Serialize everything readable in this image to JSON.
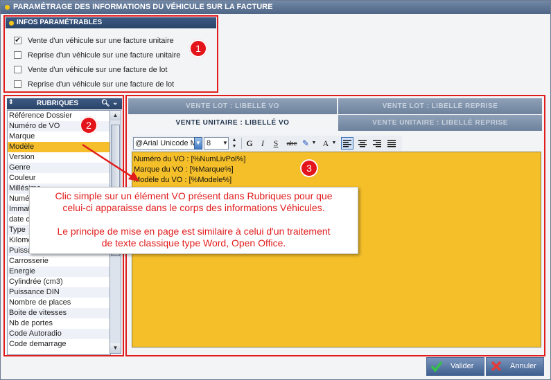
{
  "window": {
    "title": "PARAMÉTRAGE DES INFORMATIONS DU VÉHICULE SUR LA FACTURE"
  },
  "infos": {
    "title": "INFOS PARAMÉTRABLES",
    "options": [
      {
        "label": "Vente d'un véhicule sur une facture unitaire",
        "checked": true
      },
      {
        "label": "Reprise d'un véhicule sur une facture unitaire",
        "checked": false
      },
      {
        "label": "Vente d'un véhicule sur une facture de lot",
        "checked": false
      },
      {
        "label": "Reprise d'un véhicule sur une facture de lot",
        "checked": false
      }
    ]
  },
  "badges": [
    "1",
    "2",
    "3"
  ],
  "rubriques": {
    "title": "RUBRIQUES",
    "selected": "Modèle",
    "items": [
      "Référence Dossier",
      "Numéro de VO",
      "Marque",
      "Modèle",
      "Version",
      "Genre",
      "Couleur",
      "Millésime",
      "Numéro",
      "Immatriculation",
      "date de",
      "Type",
      "Kilométrage",
      "Puissance fiscale",
      "Carrosserie",
      "Energie",
      "Cylindrée (cm3)",
      "Puissance DIN",
      "Nombre de places",
      "Boite de vitesses",
      "Nb de portes",
      "Code Autoradio",
      "Code demarrage"
    ]
  },
  "tabs": {
    "vente_lot": "VENTE LOT : LIBELLÉ VO",
    "vente_lot_reprise": "VENTE LOT : LIBELLÉ REPRISE",
    "vente_unitaire": "VENTE UNITAIRE : LIBELLÉ VO",
    "vente_unitaire_reprise": "VENTE UNITAIRE : LIBELLÉ REPRISE"
  },
  "toolbar": {
    "font": "@Arial Unicode MS",
    "size": "8",
    "bold": "G",
    "italic": "I",
    "underline": "S",
    "strike": "abe",
    "font_color": "A"
  },
  "editor": {
    "lines": [
      "Numéro du VO : [%NumLivPol%]",
      "Marque du VO : [%Marque%]",
      "Modèle du VO : [%Modele%]"
    ]
  },
  "callout": {
    "line1": "Clic simple sur un élément VO présent dans Rubriques pour que",
    "line2": "celui-ci apparaisse dans le corps des informations Véhicules.",
    "line3": "Le principe de mise en page est similaire à celui d'un traitement",
    "line4": "de texte classique type Word, Open Office."
  },
  "buttons": {
    "validate": "Valider",
    "cancel": "Annuler"
  },
  "colors": {
    "accent_red": "#e11c1c",
    "editor_bg": "#f5bf2a",
    "header_blue": "#2a4468"
  }
}
